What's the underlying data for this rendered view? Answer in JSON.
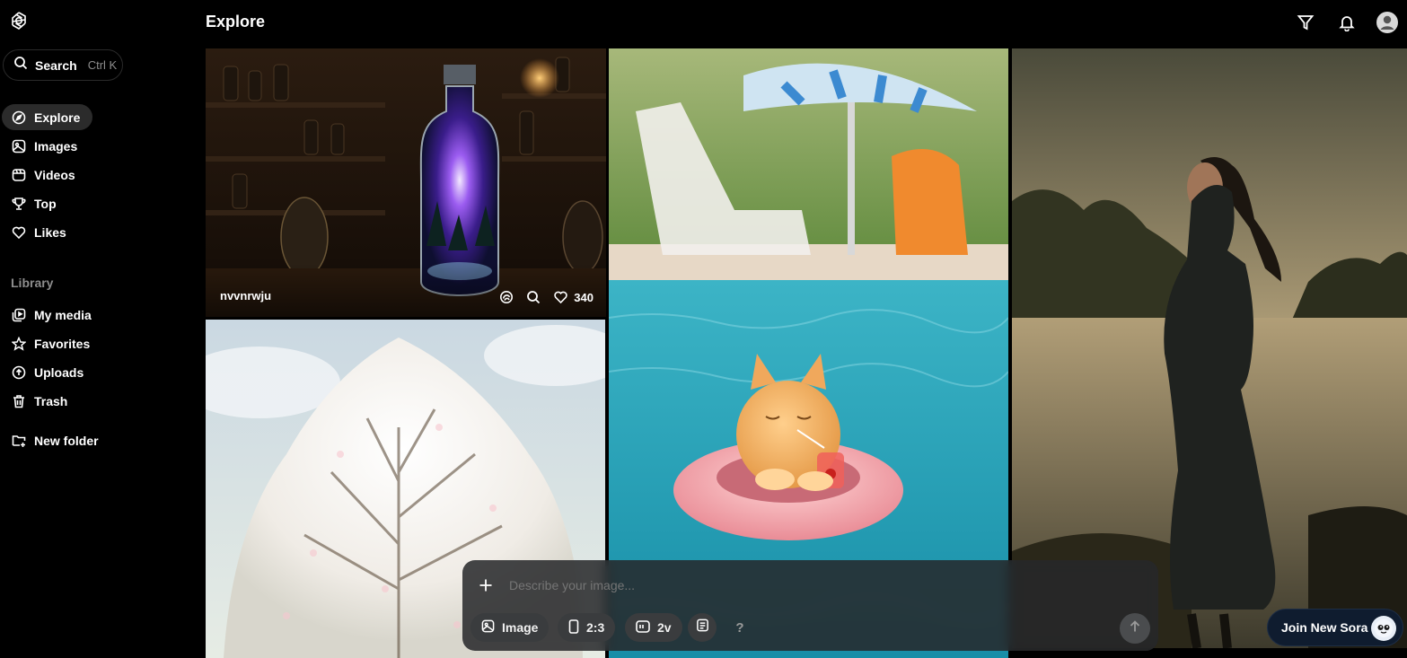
{
  "sidebar": {
    "search": {
      "label": "Search",
      "shortcut": "Ctrl K"
    },
    "nav": [
      {
        "label": "Explore",
        "icon": "compass-icon",
        "active": true
      },
      {
        "label": "Images",
        "icon": "image-icon"
      },
      {
        "label": "Videos",
        "icon": "film-icon"
      },
      {
        "label": "Top",
        "icon": "trophy-icon"
      },
      {
        "label": "Likes",
        "icon": "heart-icon"
      }
    ],
    "library_label": "Library",
    "library": [
      {
        "label": "My media",
        "icon": "media-icon"
      },
      {
        "label": "Favorites",
        "icon": "star-icon"
      },
      {
        "label": "Uploads",
        "icon": "upload-icon"
      },
      {
        "label": "Trash",
        "icon": "trash-icon"
      }
    ],
    "new_folder": {
      "label": "New folder",
      "icon": "folder-plus-icon"
    }
  },
  "header": {
    "title": "Explore",
    "icons": [
      "filter-icon",
      "bell-icon",
      "profile-icon"
    ]
  },
  "feed": {
    "tiles": [
      {
        "id": "galaxy-bottle",
        "author": "nvvnrwju",
        "likes": "340"
      },
      {
        "id": "kitten-pool"
      },
      {
        "id": "woman-river"
      },
      {
        "id": "blossom-tree"
      }
    ]
  },
  "composer": {
    "placeholder": "Describe your image...",
    "type_label": "Image",
    "ratio_label": "2:3",
    "variations_label": "2v",
    "help_label": "?"
  },
  "promo": {
    "label": "Join New Sora"
  },
  "colors": {
    "background": "#000000",
    "active_nav": "#2b2b2b",
    "composer": "#26282a",
    "promo": "#0f1c2f"
  }
}
